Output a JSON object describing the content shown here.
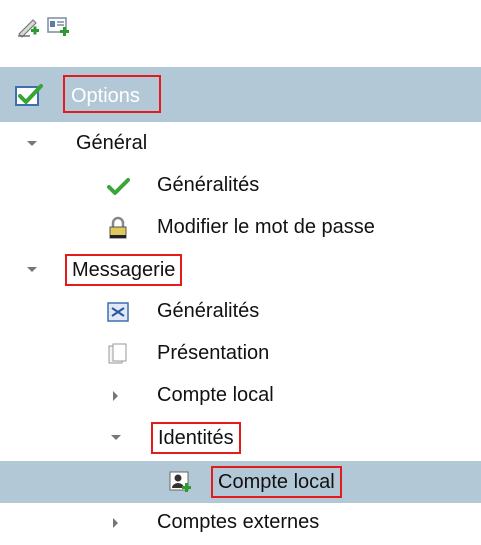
{
  "toolbar": {
    "icons": [
      "add-pen-icon",
      "add-contact-card-icon"
    ]
  },
  "header": {
    "title": "Options",
    "icon": "checkbox-checked-icon",
    "colors": {
      "background": "#b3c8d6",
      "highlight_border": "#e31b1b"
    }
  },
  "tree": {
    "general": {
      "label": "Général",
      "items": [
        {
          "label": "Généralités",
          "icon": "green-check-icon"
        },
        {
          "label": "Modifier le mot de passe",
          "icon": "padlock-icon"
        }
      ]
    },
    "messagerie": {
      "label": "Messagerie",
      "items": [
        {
          "label": "Généralités",
          "icon": "mail-settings-icon"
        },
        {
          "label": "Présentation",
          "icon": "pages-icon"
        },
        {
          "label": "Compte local"
        },
        {
          "label": "Identités"
        },
        {
          "label": "Compte local",
          "icon": "user-card-icon"
        },
        {
          "label": "Comptes externes"
        }
      ]
    }
  }
}
